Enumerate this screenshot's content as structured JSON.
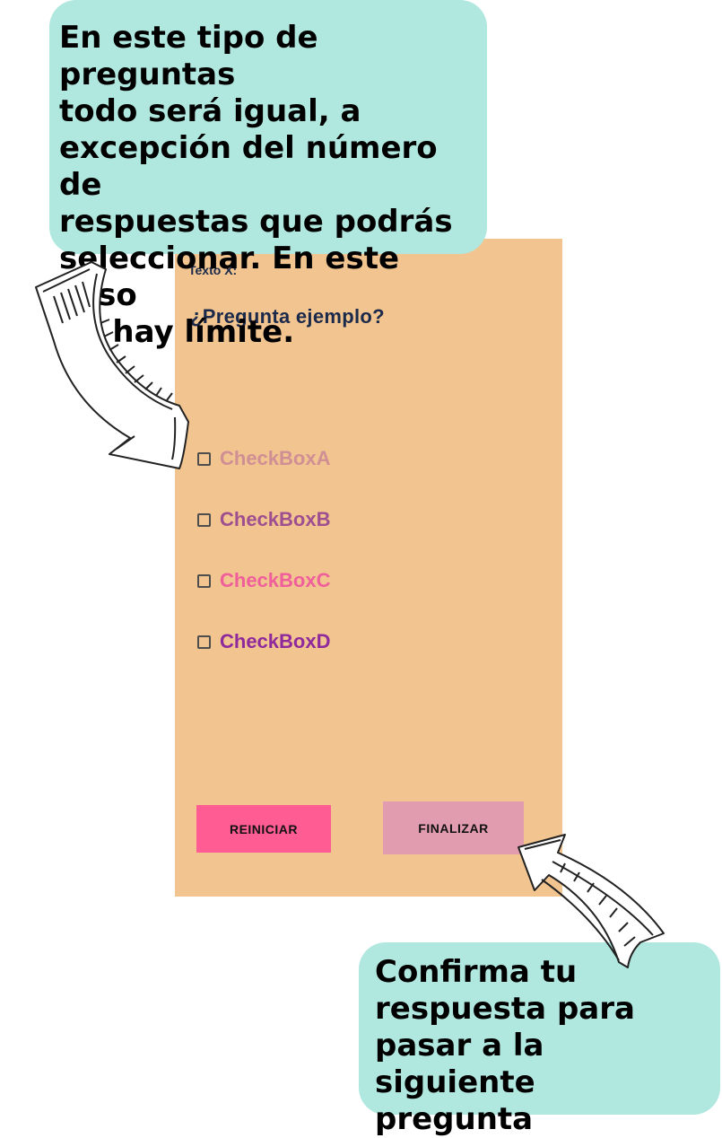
{
  "top_callout": {
    "lines": [
      "En este tipo de preguntas",
      "todo será igual, a",
      "excepción del número de",
      "respuestas que podrás",
      "seleccionar. En este caso",
      "no hay límite."
    ]
  },
  "screen": {
    "header_label": "Texto X:",
    "question": "¿Pregunta ejemplo?",
    "options": [
      {
        "label": "CheckBoxA",
        "color": "#cf8f95"
      },
      {
        "label": "CheckBoxB",
        "color": "#9d4f90"
      },
      {
        "label": "CheckBoxC",
        "color": "#ef5f9b"
      },
      {
        "label": "CheckBoxD",
        "color": "#8f2a9c"
      }
    ],
    "reset_button": "REINICIAR",
    "finish_button": "FINALIZAR"
  },
  "bottom_callout": {
    "lines": [
      "Confirma tu",
      "respuesta para",
      "pasar a la siguiente",
      "pregunta"
    ]
  },
  "colors": {
    "callout_bg": "#b0e8df",
    "screen_bg": "#f2c48f",
    "reset_bg": "#ff5c93",
    "finish_bg": "#e29caf"
  }
}
